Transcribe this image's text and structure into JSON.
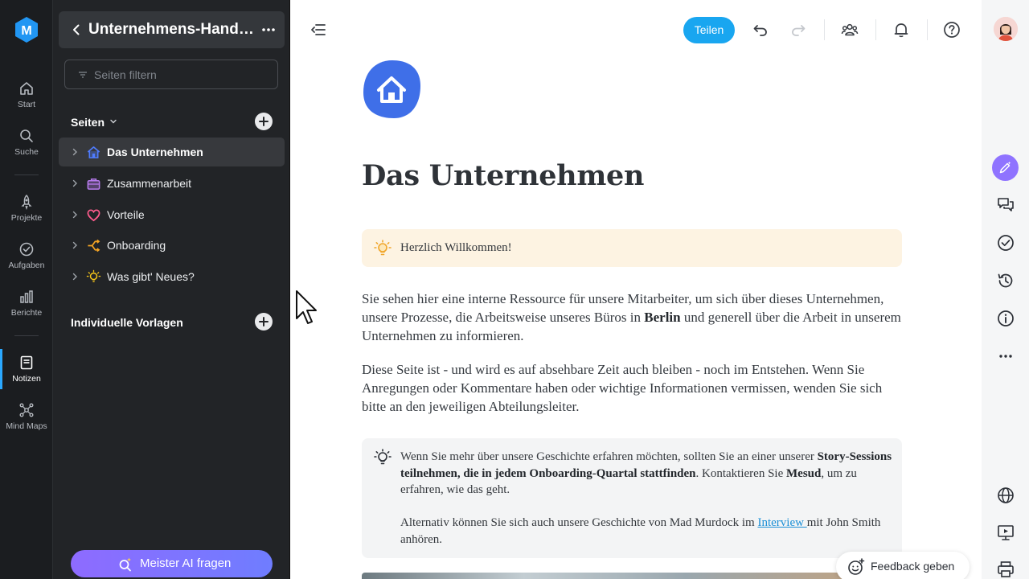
{
  "rail": {
    "items": [
      {
        "label": "Start",
        "icon": "home-icon"
      },
      {
        "label": "Suche",
        "icon": "search-icon"
      },
      {
        "label": "Projekte",
        "icon": "rocket-icon"
      },
      {
        "label": "Aufgaben",
        "icon": "check-circle-icon"
      },
      {
        "label": "Berichte",
        "icon": "bar-chart-icon"
      },
      {
        "label": "Notizen",
        "icon": "note-icon"
      },
      {
        "label": "Mind Maps",
        "icon": "mindmap-icon"
      }
    ],
    "active": "Notizen"
  },
  "sidebar": {
    "title": "Unternehmens-Hand…",
    "filter_placeholder": "Seiten filtern",
    "sections": {
      "pages": "Seiten",
      "templates": "Individuelle Vorlagen"
    },
    "pages": [
      {
        "label": "Das Unternehmen",
        "icon": "house-icon",
        "active": true
      },
      {
        "label": "Zusammenarbeit",
        "icon": "briefcase-icon",
        "active": false
      },
      {
        "label": "Vorteile",
        "icon": "heart-icon",
        "active": false
      },
      {
        "label": "Onboarding",
        "icon": "flow-icon",
        "active": false
      },
      {
        "label": "Was gibt' Neues?",
        "icon": "lightbulb-icon",
        "active": false
      }
    ],
    "ai_button": "Meister AI fragen"
  },
  "toolbar": {
    "share_label": "Teilen"
  },
  "document": {
    "title": "Das Unternehmen",
    "welcome_callout": "Herzlich Willkommen!",
    "para1": {
      "before": "Sie sehen hier eine interne Ressource für unsere Mitarbeiter, um sich über dieses Unternehmen, unsere Prozesse, die Arbeitsweise unseres Büros in ",
      "bold": "Berlin",
      "after": " und generell über die Arbeit in unserem Unternehmen zu informieren."
    },
    "para2": "Diese Seite ist - und wird es auf absehbare Zeit auch bleiben - noch im Entstehen. Wenn Sie Anregungen oder Kommentare haben oder wichtige Informationen vermissen, wenden Sie sich bitte an den jeweiligen Abteilungsleiter.",
    "info_callout": {
      "t1": "Wenn Sie mehr über unsere Geschichte erfahren möchten, sollten Sie an einer unserer ",
      "b1": "Story-Sessions teilnehmen, die in jedem Onboarding-Quartal stattfinden",
      "t2": ". Kontaktieren Sie ",
      "b2": "Mesud",
      "t3": ", um zu erfahren, wie das geht.",
      "t4": "Alternativ können Sie sich auch unsere Geschichte von Mad Murdock im ",
      "link": "Interview ",
      "t5": "mit John Smith anhören."
    }
  },
  "feedback_label": "Feedback geben",
  "colors": {
    "accent": "#19a6f0",
    "ai_purple": "#8f73ff",
    "warm_callout": "#fdf3e2",
    "grey_callout": "#f3f4f5",
    "doc_icon": "#3f6fe8"
  }
}
